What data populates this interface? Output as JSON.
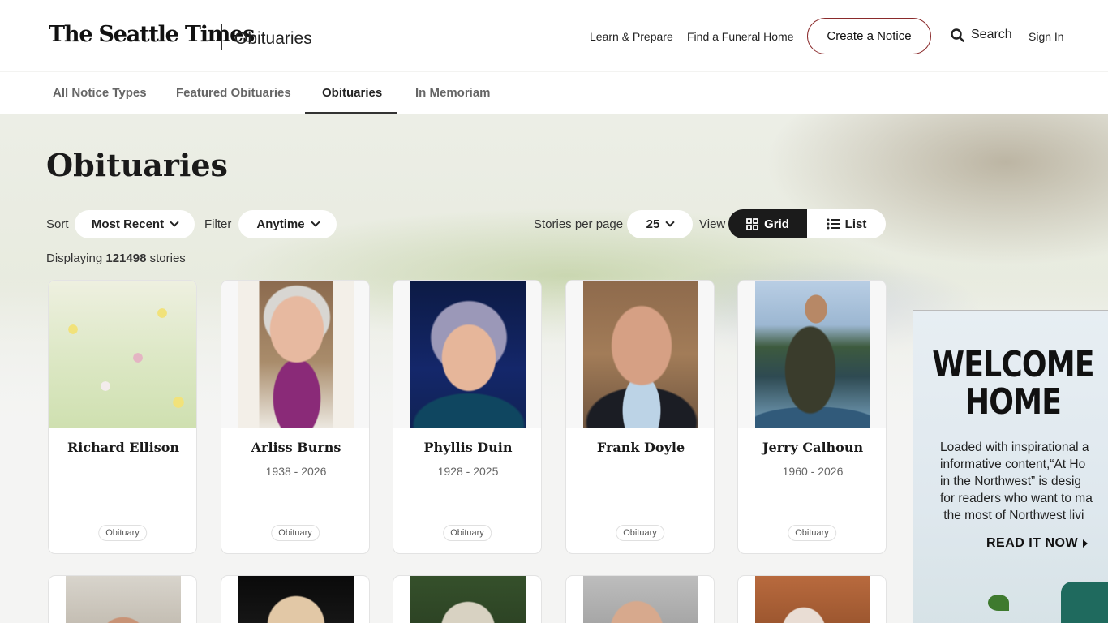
{
  "header": {
    "logo": "The Seattle Times",
    "section": "Obituaries",
    "nav": [
      "Learn & Prepare",
      "Find a Funeral Home"
    ],
    "create_label": "Create a Notice",
    "search_label": "Search",
    "signin_label": "Sign In"
  },
  "tabs": [
    "All Notice Types",
    "Featured Obituaries",
    "Obituaries",
    "In Memoriam"
  ],
  "page": {
    "title": "Obituaries",
    "sort_label": "Sort",
    "sort_value": "Most Recent",
    "filter_label": "Filter",
    "filter_value": "Anytime",
    "per_page_label": "Stories per page",
    "per_page_value": "25",
    "view_label": "View",
    "view_grid": "Grid",
    "view_list": "List",
    "displaying_prefix": "Displaying",
    "displaying_count": "121498",
    "displaying_suffix": "stories"
  },
  "cards": [
    {
      "name": "Richard Ellison",
      "years": "",
      "type": "Obituary"
    },
    {
      "name": "Arliss Burns",
      "years": "1938 - 2026",
      "type": "Obituary"
    },
    {
      "name": "Phyllis Duin",
      "years": "1928 - 2025",
      "type": "Obituary"
    },
    {
      "name": "Frank Doyle",
      "years": "",
      "type": "Obituary"
    },
    {
      "name": "Jerry Calhoun",
      "years": "1960 - 2026",
      "type": "Obituary"
    }
  ],
  "ad": {
    "headline_1": "WELCOME",
    "headline_2": "HOME",
    "body_1": "Loaded with inspirational a",
    "body_2": "informative content,“At Ho",
    "body_3": "in the Northwest” is desig",
    "body_4": "for readers who want to ma",
    "body_5": " the most of Northwest livi",
    "cta": "READ IT NOW"
  }
}
